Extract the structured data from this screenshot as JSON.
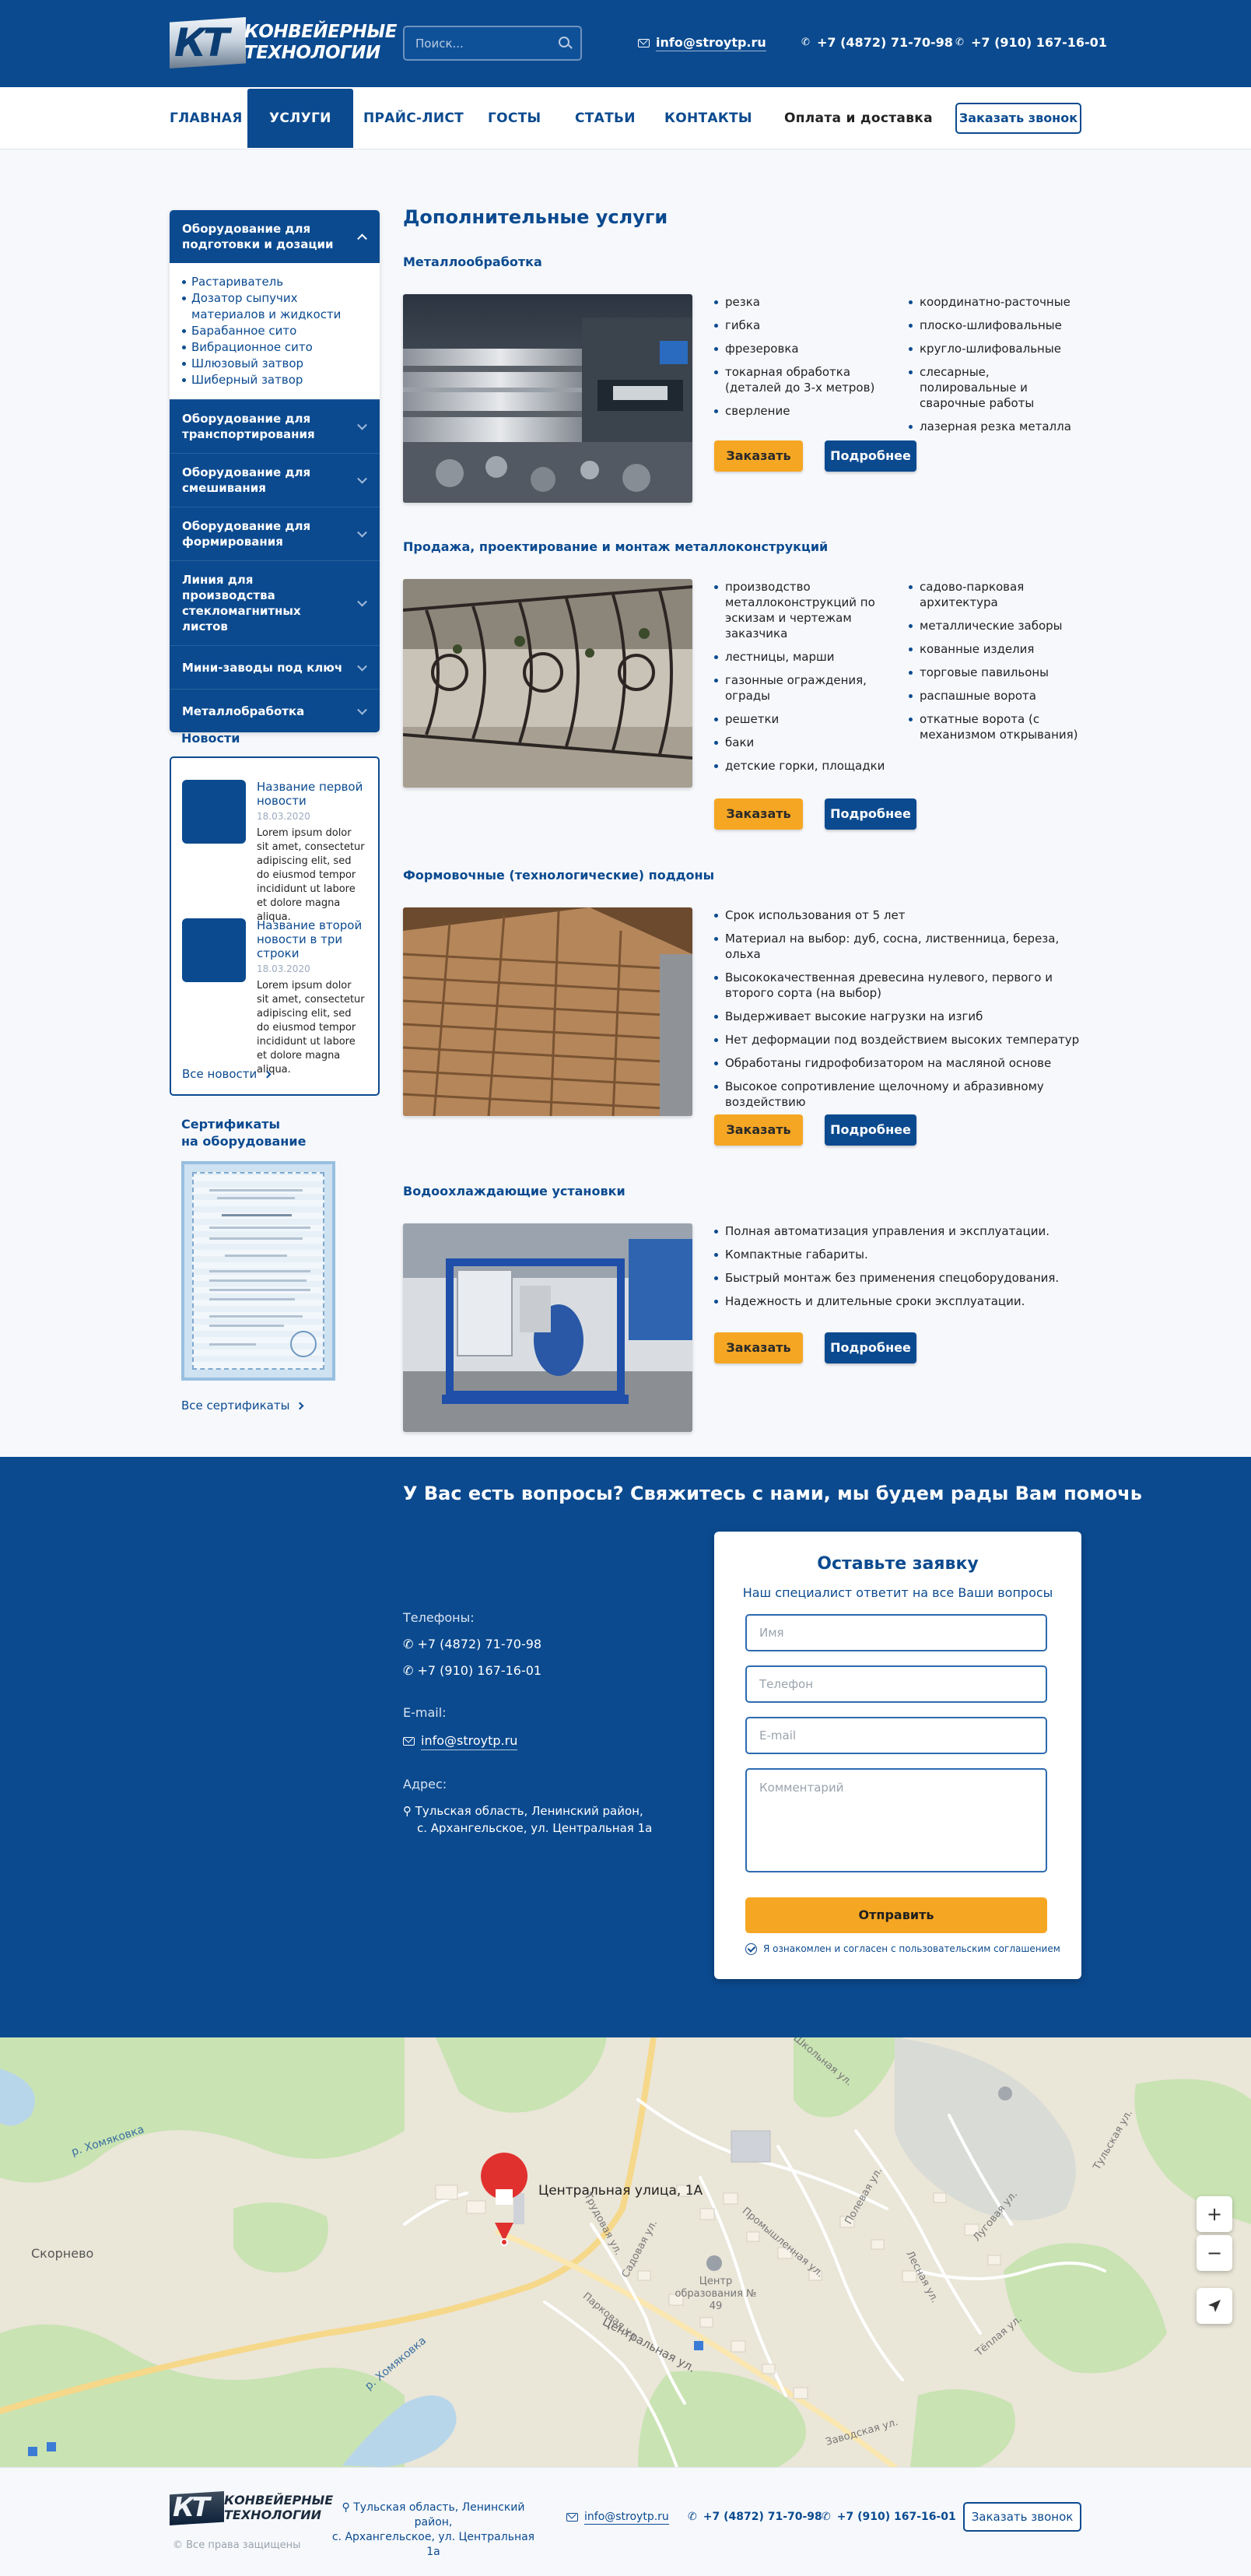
{
  "brand": {
    "logo_letters": "КТ",
    "name_line1": "КОНВЕЙЕРНЫЕ",
    "name_line2": "ТЕХНОЛОГИИ"
  },
  "header": {
    "search_placeholder": "Поиск...",
    "email": "info@stroytp.ru",
    "phone1": "+7 (4872) 71-70-98",
    "phone2": "+7 (910) 167-16-01"
  },
  "nav": {
    "items": [
      "ГЛАВНАЯ",
      "УСЛУГИ",
      "ПРАЙС-ЛИСТ",
      "ГОСТЫ",
      "СТАТЬИ",
      "КОНТАКТЫ"
    ],
    "delivery": "Оплата и доставка",
    "callback": "Заказать звонок",
    "active_index": 1
  },
  "sidebar": {
    "categories": [
      {
        "label": "Оборудование для подготовки и дозации",
        "open": true,
        "items": [
          "Растариватель",
          "Дозатор сыпучих материалов и жидкости",
          "Барабанное сито",
          "Вибрационное сито",
          "Шлюзовый затвор",
          "Шиберный затвор"
        ]
      },
      {
        "label": "Оборудование для транспортирования"
      },
      {
        "label": "Оборудование для смешивания"
      },
      {
        "label": "Оборудование для формирования"
      },
      {
        "label": "Линия для производства стекломагнитных листов"
      },
      {
        "label": "Мини-заводы под ключ"
      },
      {
        "label": "Металлобработка"
      }
    ],
    "news_title": "Новости",
    "news": [
      {
        "title": "Название первой новости",
        "date": "18.03.2020",
        "text": "Lorem ipsum dolor sit amet, consectetur adipiscing elit, sed do eiusmod tempor incididunt ut labore et dolore magna aliqua."
      },
      {
        "title": "Название второй новости в три строки",
        "date": "18.03.2020",
        "text": "Lorem ipsum dolor sit amet, consectetur adipiscing elit, sed do eiusmod tempor incididunt ut labore et dolore magna aliqua."
      }
    ],
    "all_news": "Все новости",
    "certs_title_1": "Сертификаты",
    "certs_title_2": "на оборудование",
    "all_certs": "Все сертификаты"
  },
  "content": {
    "title": "Дополнительные услуги",
    "order_label": "Заказать",
    "more_label": "Подробнее",
    "sections": [
      {
        "title": "Металлообработка",
        "col1": [
          "резка",
          "гибка",
          "фрезеровка",
          "токарная обработка (деталей до 3-х метров)",
          "сверление"
        ],
        "col2": [
          "координатно-расточные",
          "плоско-шлифовальные",
          "кругло-шлифовальные",
          "слесарные, полировальные и сварочные работы",
          "лазерная резка металла"
        ]
      },
      {
        "title": "Продажа, проектирование и монтаж металлоконструкций",
        "col1": [
          "производство металлоконструкций по эскизам и чертежам заказчика",
          "лестницы, марши",
          "газонные ограждения, ограды",
          "решетки",
          "баки",
          "детские горки, площадки"
        ],
        "col2": [
          "садово-парковая архитектура",
          "металлические заборы",
          "кованные изделия",
          "торговые павильоны",
          "распашные ворота",
          "откатные ворота (с механизмом открывания)"
        ]
      },
      {
        "title": "Формовочные (технологические) поддоны",
        "col1": [
          "Срок использования от 5 лет",
          "Материал на выбор: дуб, сосна, лиственница, береза, ольха",
          "Высококачественная древесина нулевого, первого и второго сорта (на выбор)",
          "Выдерживает высокие нагрузки на изгиб",
          "Нет деформации под воздействием высоких температур",
          "Обработаны гидрофобизатором на масляной основе",
          "Высокое сопротивление щелочному и абразивному воздействию"
        ]
      },
      {
        "title": "Водоохлаждающие установки",
        "col1": [
          "Полная автоматизация управления и эксплуатации.",
          "Компактные габариты.",
          "Быстрый монтаж без применения спецоборудования.",
          "Надежность и длительные сроки эксплуатации."
        ]
      }
    ]
  },
  "contact": {
    "heading": "У Вас есть вопросы? Свяжитесь с нами, мы будем рады Вам помочь",
    "phones_label": "Телефоны:",
    "phone1": "+7 (4872) 71-70-98",
    "phone2": "+7 (910) 167-16-01",
    "email_label": "E-mail:",
    "email": "info@stroytp.ru",
    "address_label": "Адрес:",
    "address_line1": "Тульская область, Ленинский район,",
    "address_line2": "с. Архангельское, ул. Центральная 1а",
    "form": {
      "title": "Оставьте заявку",
      "subtitle": "Наш специалист ответит на все Ваши вопросы",
      "name_ph": "Имя",
      "phone_ph": "Телефон",
      "email_ph": "E-mail",
      "comment_ph": "Комментарий",
      "submit": "Отправить",
      "agree": "Я ознакомлен и согласен с пользовательским соглашением"
    }
  },
  "map": {
    "marker_label": "Центральная улица, 1А",
    "village": "Скорнево",
    "river": "р. Хомяковка",
    "river2": "р. Хомяковка",
    "streets": [
      "Центральная ул.",
      "Садовая ул.",
      "Трудовая ул.",
      "Лесная ул.",
      "Луговая ул.",
      "Полевая ул.",
      "Парковая ул.",
      "Промышленная ул.",
      "Школьная ул.",
      "Заводская ул.",
      "Тёплая ул.",
      "Тульская ул."
    ],
    "center_label_1": "Центр",
    "center_label_2": "образования № 49",
    "zoom_in": "+",
    "zoom_out": "−"
  },
  "footer": {
    "copyright": "©  Все права защищены",
    "address_line1": "Тульская область, Ленинский район,",
    "address_line2": "с. Архангельское, ул. Центральная 1а",
    "email": "info@stroytp.ru",
    "phone1": "+7 (4872)  71-70-98",
    "phone2": "+7 (910) 167-16-01",
    "callback": "Заказать звонок"
  },
  "colors": {
    "primary": "#0b4a8f",
    "accent": "#f5a623",
    "background": "#f6f8fc"
  }
}
